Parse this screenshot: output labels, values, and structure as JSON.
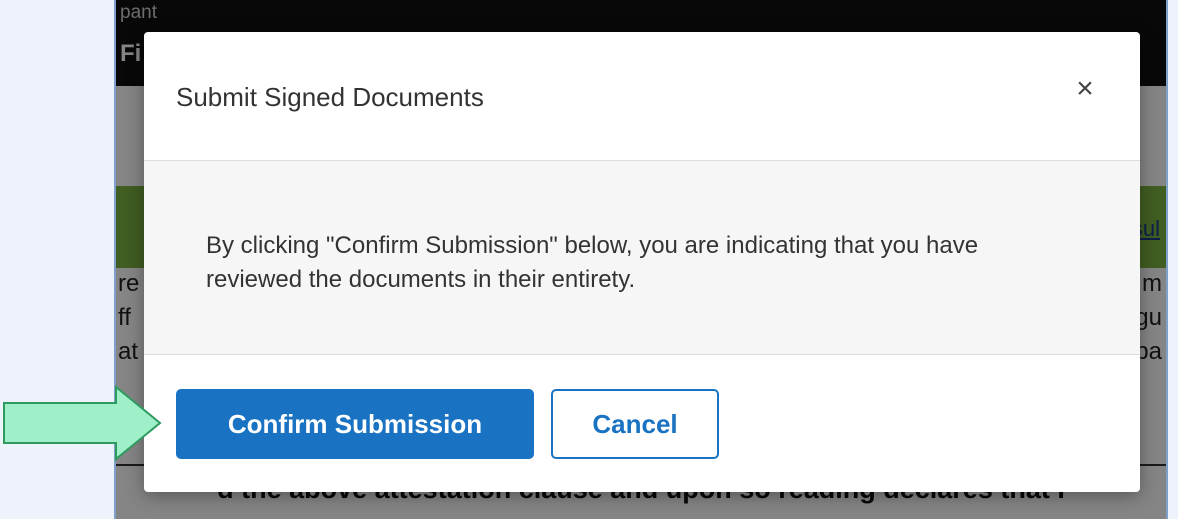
{
  "background": {
    "header_sub": "pant",
    "header_title": "Fi",
    "green_link": "sul",
    "line1_left": "re",
    "line1_right": "m",
    "line2_left": "ff",
    "line2_right": "gu",
    "line3_left": "at",
    "line3_right": "pa",
    "bottom_text": "d the above attestation clause and upon so reading declares that I"
  },
  "modal": {
    "title": "Submit Signed Documents",
    "close_symbol": "×",
    "body_text": "By clicking \"Confirm Submission\" below, you are indicating that you have reviewed the documents in their entirety.",
    "confirm_label": "Confirm Submission",
    "cancel_label": "Cancel"
  },
  "colors": {
    "primary": "#1a73c2",
    "arrow_fill": "#9ff0c8",
    "arrow_stroke": "#2e9a5e"
  },
  "icons": {
    "close": "close-icon",
    "arrow": "annotation-arrow-icon"
  }
}
